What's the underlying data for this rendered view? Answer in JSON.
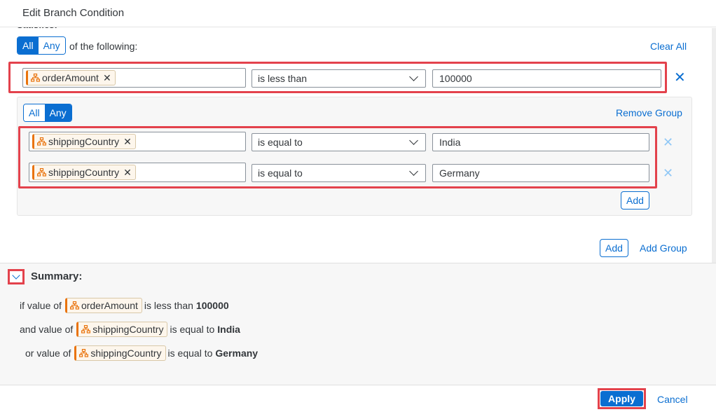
{
  "dialog": {
    "title": "Edit Branch Condition"
  },
  "condition": {
    "satisfies_label": "Satisfies:",
    "toggle": {
      "all": "All",
      "any": "Any",
      "selected": "All"
    },
    "of_following": "of the following:",
    "clear_all": "Clear All",
    "row1": {
      "token": "orderAmount",
      "operator": "is less than",
      "value": "100000"
    }
  },
  "group": {
    "toggle": {
      "all": "All",
      "any": "Any",
      "selected": "Any"
    },
    "remove_group": "Remove Group",
    "rows": [
      {
        "token": "shippingCountry",
        "operator": "is equal to",
        "value": "India"
      },
      {
        "token": "shippingCountry",
        "operator": "is equal to",
        "value": "Germany"
      }
    ],
    "add": "Add"
  },
  "actions": {
    "add": "Add",
    "add_group": "Add Group"
  },
  "summary": {
    "title": "Summary:",
    "lines": [
      {
        "prefix": "if value of",
        "token": "orderAmount",
        "op": "is less than",
        "value": "100000"
      },
      {
        "prefix": "and value of",
        "token": "shippingCountry",
        "op": "is equal to",
        "value": "India"
      },
      {
        "prefix": "or value of",
        "token": "shippingCountry",
        "op": "is equal to",
        "value": "Germany"
      }
    ]
  },
  "footer": {
    "apply": "Apply",
    "cancel": "Cancel"
  },
  "colors": {
    "accent": "#0a6ed1",
    "highlight": "#e3424c",
    "token_border": "#e9730c"
  }
}
